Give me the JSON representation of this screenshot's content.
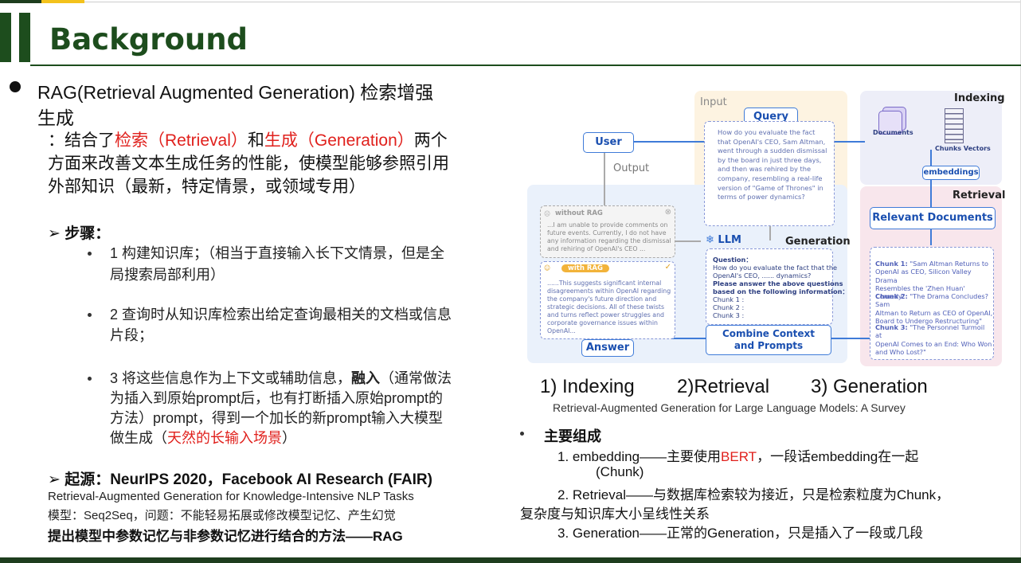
{
  "slide": {
    "title": "Background",
    "rag_heading": "RAG(Retrieval Augmented Generation) 检索增强",
    "rag_heading_2": "生成",
    "desc_1_prefix": "：结合了",
    "desc_1_red1": "检索（Retrieval）",
    "desc_1_mid": "和",
    "desc_1_red2": "生成（Generation）",
    "desc_1_suffix": "两个",
    "desc_2": "方面来改善文本生成任务的性能，使模型能够参照引用",
    "desc_3": "外部知识（最新，特定情景，或领域专用）",
    "steps_heading": "步骤：",
    "step1_l1": "1 构建知识库；（相当于直接输入长下文情景，但是全",
    "step1_l2": "局搜索局部利用）",
    "step2_l1": "2 查询时从知识库检索出给定查询最相关的文档或信息",
    "step2_l2": "片段；",
    "step3_l1_a": "3 将这些信息作为上下文或辅助信息，",
    "step3_l1_b": "融入",
    "step3_l1_c": "（通常做法",
    "step3_l2": "为插入到原始prompt后，也有打断插入原始prompt的",
    "step3_l3": "方法）prompt，得到一个加长的新prompt输入大模型",
    "step3_l4_a": "做生成（",
    "step3_l4_red": "天然的长输入场景",
    "step3_l4_b": "）",
    "origin_heading": "起源：NeurIPS 2020，Facebook AI Research (FAIR)",
    "origin_paper": "Retrieval-Augmented Generation for Knowledge-Intensive NLP Tasks",
    "origin_model": "模型：Seq2Seq，问题：不能轻易拓展或修改模型记忆、产生幻觉",
    "origin_method": "提出模型中参数记忆与非参数记忆进行结合的方法——RAG",
    "stages_1": "1) Indexing",
    "stages_2": "2)Retrieval",
    "stages_3": "3) Generation",
    "survey_title": "Retrieval-Augmented Generation for Large Language Models: A Survey",
    "components_heading": "主要组成",
    "comp1_a": "1. embedding——主要使用",
    "comp1_red": "BERT",
    "comp1_b": "，一段话embedding在一起",
    "comp1_l2": "(Chunk)",
    "comp2_l1": "2. Retrieval——与数据库检索较为接近，只是检索粒度为Chunk，",
    "comp2_l2": "复杂度与知识库大小呈线性关系",
    "comp3": "3. Generation——正常的Generation，只是插入了一段或几段"
  },
  "diagram": {
    "input_label": "Input",
    "query_label": "Query",
    "query_text": [
      "How do you evaluate the fact",
      "that OpenAI's CEO, Sam Altman,",
      "went through a sudden dismissal",
      "by the board in just three days,",
      "and then was rehired by the",
      "company, resembling a real-life",
      "version of \"Game of Thrones\" in",
      "terms of power dynamics?"
    ],
    "user_label": "User",
    "output_label": "Output",
    "indexing_label": "Indexing",
    "documents_label": "Documents",
    "chunks_label": "Chunks Vectors",
    "embeddings_label": "embeddings",
    "retrieval_label": "Retrieval",
    "relevant_docs_label": "Relevant Documents",
    "chunks": [
      {
        "title": "Chunk 1:",
        "text": [
          "\"Sam Altman Returns to",
          "OpenAI as CEO, Silicon Valley Drama",
          "Resembles the 'Zhen Huan' Comedy\""
        ]
      },
      {
        "title": "Chunk 2:",
        "text": [
          "\"The Drama Concludes? Sam",
          "Altman to Return as CEO of OpenAI,",
          "Board to Undergo Restructuring\""
        ]
      },
      {
        "title": "Chunk 3:",
        "text": [
          "\"The Personnel Turmoil at",
          "OpenAI Comes to an End: Who Won",
          "and Who Lost?\""
        ]
      }
    ],
    "generation_label": "Generation",
    "llm_label": "LLM",
    "without_rag_label": "without RAG",
    "without_rag_text": [
      "...I am unable to provide comments on",
      "future events. Currently, I do not have",
      "any information regarding the dismissal",
      "and rehiring of OpenAI's CEO ..."
    ],
    "with_rag_label": "with RAG",
    "with_rag_text": [
      "......This suggests significant internal",
      "disagreements within OpenAI regarding",
      "the company's future direction and",
      "strategic decisions. All of these twists",
      "and turns reflect power struggles and",
      "corporate governance issues within",
      "OpenAI..."
    ],
    "answer_label": "Answer",
    "question_label": "Question：",
    "question_text": "How do you evaluate the fact that the",
    "question_text2": "OpenAI's CEO, ...... dynamics?",
    "instruction_text": "Please answer the above questions",
    "instruction_text2": "based on the following information：",
    "chunk_refs": [
      "Chunk 1 :",
      "Chunk 2 :",
      "Chunk 3 :"
    ],
    "combine_label_1": "Combine Context",
    "combine_label_2": "and Prompts"
  },
  "colors": {
    "accent_green": "#1d4d1d",
    "gold": "#f3c21c",
    "red": "#e0201c",
    "diagram_blue": "#3f7bd8"
  }
}
